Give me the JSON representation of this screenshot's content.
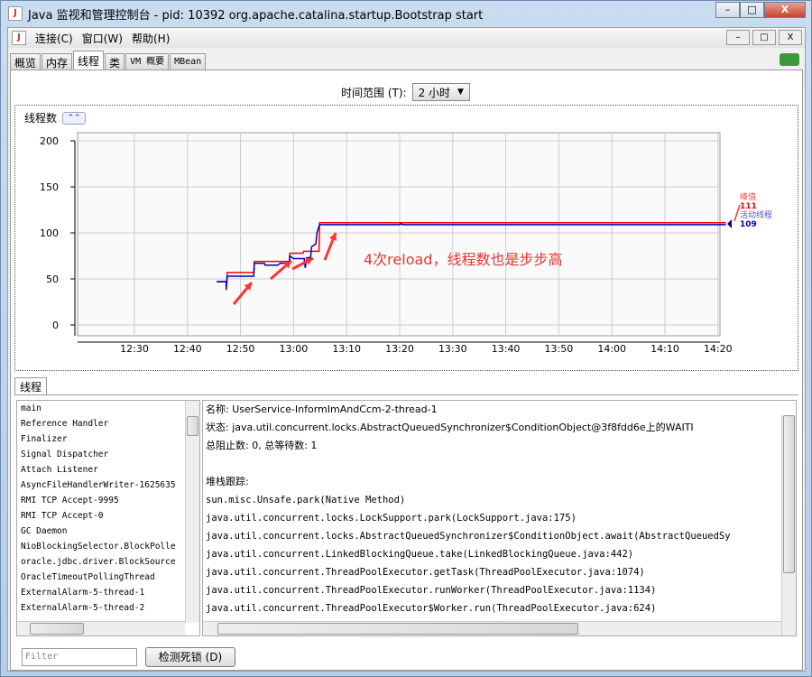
{
  "window": {
    "title": "Java 监视和管理控制台 - pid: 10392 org.apache.catalina.startup.Bootstrap start",
    "buttons": [
      "–",
      "□",
      "X"
    ]
  },
  "menu": [
    "连接(C)",
    "窗口(W)",
    "帮助(H)"
  ],
  "tabs": [
    "概览",
    "内存",
    "线程",
    "类",
    "VM 概要",
    "MBean"
  ],
  "active_tab": "线程",
  "time_range": {
    "label": "时间范围 (T):",
    "value": "2 小时"
  },
  "chart_panel": {
    "title": "线程数"
  },
  "chart_data": {
    "type": "line",
    "title": "线程数",
    "x_unit": "minutes after 12:00",
    "xlim": [
      20,
      142
    ],
    "ylim": [
      0,
      200
    ],
    "yticks": [
      0,
      50,
      100,
      150,
      200
    ],
    "xtick_values": [
      30,
      40,
      50,
      60,
      70,
      80,
      90,
      100,
      110,
      120,
      130,
      140
    ],
    "xtick_labels": [
      "12:30",
      "12:40",
      "12:50",
      "13:00",
      "13:10",
      "13:20",
      "13:30",
      "13:40",
      "13:50",
      "14:00",
      "14:10",
      "14:20"
    ],
    "grid": true,
    "series": [
      {
        "name": "峰值",
        "color": "#ff0000",
        "current": "111",
        "points": [
          [
            45.5,
            47
          ],
          [
            47.4,
            47
          ],
          [
            47.5,
            57
          ],
          [
            52.5,
            57
          ],
          [
            52.6,
            69
          ],
          [
            59.2,
            69
          ],
          [
            59.3,
            78
          ],
          [
            61.8,
            78
          ],
          [
            61.9,
            80
          ],
          [
            64.8,
            80
          ],
          [
            64.9,
            111
          ],
          [
            141.5,
            111
          ]
        ]
      },
      {
        "name": "活动线程",
        "color": "#0000aa",
        "current": "109",
        "points": [
          [
            45.5,
            47
          ],
          [
            47.3,
            47
          ],
          [
            47.3,
            38
          ],
          [
            47.5,
            53
          ],
          [
            52.5,
            53
          ],
          [
            52.6,
            67
          ],
          [
            54.5,
            67
          ],
          [
            54.6,
            65
          ],
          [
            57,
            65
          ],
          [
            57.5,
            67
          ],
          [
            59.2,
            67
          ],
          [
            59.3,
            75
          ],
          [
            60,
            72
          ],
          [
            62,
            72
          ],
          [
            62.2,
            62
          ],
          [
            62.5,
            73
          ],
          [
            63.2,
            73
          ],
          [
            63.4,
            85
          ],
          [
            64.2,
            88
          ],
          [
            64.4,
            100
          ],
          [
            64.9,
            109
          ],
          [
            80,
            109
          ],
          [
            80.1,
            110
          ],
          [
            80.5,
            109
          ],
          [
            141.5,
            109
          ]
        ]
      }
    ],
    "legend_placement": "right",
    "annotation": "4次reload，线程数也是步步高",
    "annotation_arrows_at": [
      47,
      54,
      59.5,
      64.5
    ]
  },
  "threads_tab": "线程",
  "thread_list": [
    "main",
    "Reference Handler",
    "Finalizer",
    "Signal Dispatcher",
    "Attach Listener",
    "AsyncFileHandlerWriter-1625635",
    "RMI TCP Accept-9995",
    "RMI TCP Accept-0",
    "GC Daemon",
    "NioBlockingSelector.BlockPolle",
    "oracle.jdbc.driver.BlockSource",
    "OracleTimeoutPollingThread",
    "ExternalAlarm-5-thread-1",
    "ExternalAlarm-5-thread-2"
  ],
  "detail": {
    "name_line": "名称: UserService-InformImAndCcm-2-thread-1",
    "state_line": "状态: java.util.concurrent.locks.AbstractQueuedSynchronizer$ConditionObject@3f8fdd6e上的WAITI",
    "counts_line": "总阻止数: 0, 总等待数: 1",
    "stack_label": "堆栈跟踪:",
    "stack": [
      "sun.misc.Unsafe.park(Native Method)",
      "java.util.concurrent.locks.LockSupport.park(LockSupport.java:175)",
      "java.util.concurrent.locks.AbstractQueuedSynchronizer$ConditionObject.await(AbstractQueuedSy",
      "java.util.concurrent.LinkedBlockingQueue.take(LinkedBlockingQueue.java:442)",
      "java.util.concurrent.ThreadPoolExecutor.getTask(ThreadPoolExecutor.java:1074)",
      "java.util.concurrent.ThreadPoolExecutor.runWorker(ThreadPoolExecutor.java:1134)",
      "java.util.concurrent.ThreadPoolExecutor$Worker.run(ThreadPoolExecutor.java:624)"
    ]
  },
  "filter": {
    "placeholder": "Filter"
  },
  "detect_deadlock": "检测死锁 (D)"
}
